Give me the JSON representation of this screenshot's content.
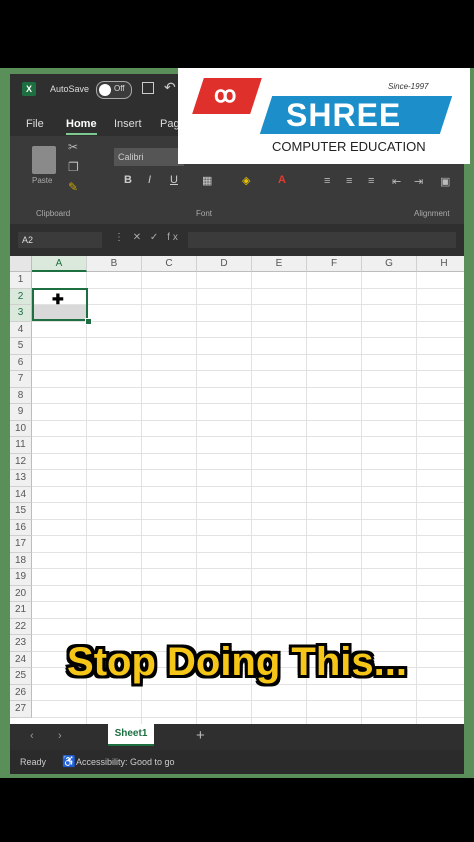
{
  "title_bar": {
    "app_icon": "X",
    "autosave_label": "AutoSave",
    "autosave_state": "Off"
  },
  "tabs": [
    "File",
    "Home",
    "Insert",
    "Pag"
  ],
  "ribbon": {
    "paste_label": "Paste",
    "font_name": "Calibri",
    "format_buttons": [
      "B",
      "I",
      "U"
    ],
    "groups": [
      "Clipboard",
      "Font",
      "Alignment"
    ]
  },
  "formula_bar": {
    "name_box": "A2",
    "fx": "fx",
    "value": ""
  },
  "columns": [
    "A",
    "B",
    "C",
    "D",
    "E",
    "F",
    "G",
    "H"
  ],
  "rows": [
    "1",
    "2",
    "3",
    "4",
    "5",
    "6",
    "7",
    "8",
    "9",
    "10",
    "11",
    "12",
    "13",
    "14",
    "15",
    "16",
    "17",
    "18",
    "19",
    "20",
    "21",
    "22",
    "23",
    "24",
    "25",
    "26",
    "27"
  ],
  "selected": {
    "column": "A",
    "rows": [
      "2",
      "3"
    ]
  },
  "sheets": {
    "tabs": [
      "Sheet1"
    ],
    "add": "+"
  },
  "status_bar": {
    "ready": "Ready",
    "accessibility": "Accessibility: Good to go"
  },
  "logo": {
    "name": "SHREE",
    "since": "Since-1997",
    "subtitle": "COMPUTER EDUCATION"
  },
  "caption": "Stop Doing This...",
  "colors": {
    "excel_green": "#1d6f42",
    "caption": "#f5c518",
    "logo_red": "#e0302b",
    "logo_blue": "#1c8ec9"
  }
}
